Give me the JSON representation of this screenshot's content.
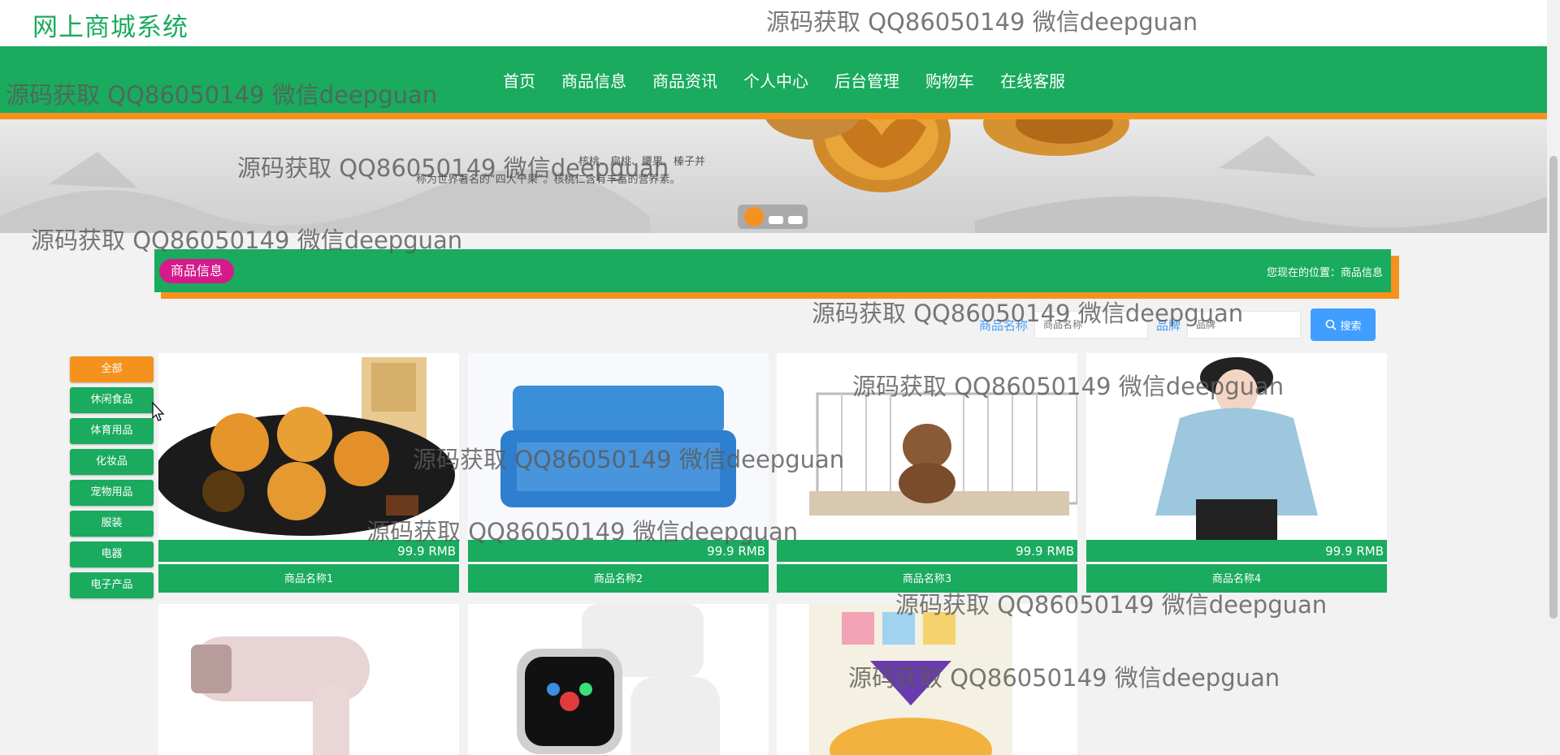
{
  "header": {
    "site_title": "网上商城系统"
  },
  "nav": {
    "items": [
      "首页",
      "商品信息",
      "商品资讯",
      "个人中心",
      "后台管理",
      "购物车",
      "在线客服"
    ]
  },
  "banner": {
    "line1": "核桃、扁桃、腰果、榛子并",
    "line2": "称为世界著名的“四大干果”。核桃仁含有丰富的营养素。"
  },
  "section": {
    "title": "商品信息",
    "breadcrumb": "您现在的位置：商品信息"
  },
  "search": {
    "name_label": "商品名称",
    "name_placeholder": "商品名称",
    "brand_label": "品牌",
    "brand_placeholder": "品牌",
    "button_label": "搜索"
  },
  "categories": [
    "全部",
    "休闲食品",
    "体育用品",
    "化妆品",
    "宠物用品",
    "服装",
    "电器",
    "电子产品"
  ],
  "products": [
    {
      "name": "商品名称1",
      "price": "99.9 RMB"
    },
    {
      "name": "商品名称2",
      "price": "99.9 RMB"
    },
    {
      "name": "商品名称3",
      "price": "99.9 RMB"
    },
    {
      "name": "商品名称4",
      "price": "99.9 RMB"
    }
  ],
  "watermark": "源码获取 QQ86050149 微信deepguan",
  "colors": {
    "primary_green": "#1aab5e",
    "accent_orange": "#f5921e",
    "badge_pink": "#d61a8c",
    "search_blue": "#409eff"
  }
}
